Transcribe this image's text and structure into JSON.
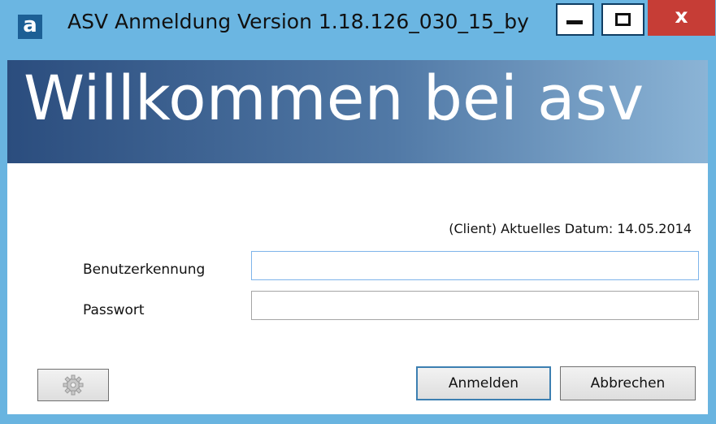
{
  "window": {
    "app_icon_letter": "a",
    "title": "ASV Anmeldung Version 1.18.126_030_15_by",
    "close_glyph": "x",
    "icons": [
      "app-icon",
      "minimize-icon",
      "maximize-icon",
      "close-icon",
      "gear-icon"
    ]
  },
  "banner": {
    "text": "Willkommen bei asv"
  },
  "form": {
    "date_text": "(Client) Aktuelles Datum: 14.05.2014",
    "username_label": "Benutzerkennung",
    "username_value": "",
    "password_label": "Passwort",
    "password_value": ""
  },
  "buttons": {
    "login": "Anmelden",
    "cancel": "Abbrechen"
  },
  "colors": {
    "titlebar": "#6bb6e2",
    "close_button": "#c63d36",
    "banner_start": "#2b4d7e",
    "banner_end": "#8bb4d6",
    "default_button_border": "#3c7fb1"
  }
}
